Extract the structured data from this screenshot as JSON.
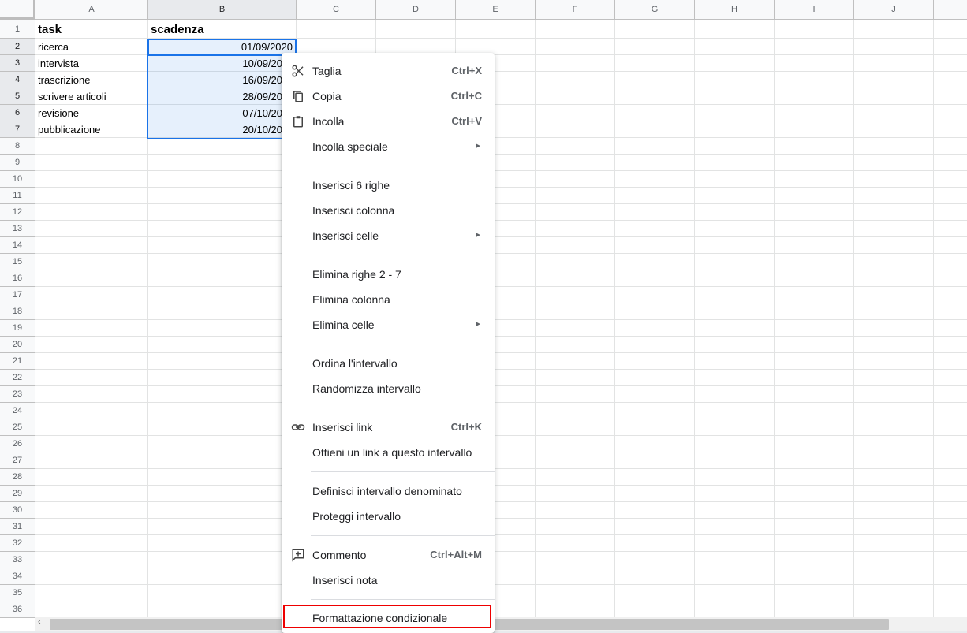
{
  "columns": [
    "A",
    "B",
    "C",
    "D",
    "E",
    "F",
    "G",
    "H",
    "I",
    "J"
  ],
  "rows": [
    "1",
    "2",
    "3",
    "4",
    "5",
    "6",
    "7",
    "8",
    "9",
    "10",
    "11",
    "12",
    "13",
    "14",
    "15",
    "16",
    "17",
    "18",
    "19",
    "20",
    "21",
    "22",
    "23",
    "24",
    "25",
    "26",
    "27",
    "28",
    "29",
    "30",
    "31",
    "32",
    "33",
    "34",
    "35",
    "36"
  ],
  "cells": {
    "A1": "task",
    "B1": "scadenza",
    "A2": "ricerca",
    "B2": "01/09/2020",
    "A3": "intervista",
    "B3": "10/09/20",
    "A4": "trascrizione",
    "B4": "16/09/20",
    "A5": "scrivere articoli",
    "B5": "28/09/20",
    "A6": "revisione",
    "B6": "07/10/20",
    "A7": "pubblicazione",
    "B7": "20/10/20"
  },
  "context_menu": {
    "cut": {
      "label": "Taglia",
      "shortcut": "Ctrl+X",
      "icon": "scissors-icon"
    },
    "copy": {
      "label": "Copia",
      "shortcut": "Ctrl+C",
      "icon": "copy-icon"
    },
    "paste": {
      "label": "Incolla",
      "shortcut": "Ctrl+V",
      "icon": "clipboard-icon"
    },
    "paste_special": {
      "label": "Incolla speciale",
      "arrow": "►"
    },
    "insert_rows": {
      "label": "Inserisci 6 righe"
    },
    "insert_column": {
      "label": "Inserisci colonna"
    },
    "insert_cells": {
      "label": "Inserisci celle",
      "arrow": "►"
    },
    "delete_rows": {
      "label": "Elimina righe 2 - 7"
    },
    "delete_column": {
      "label": "Elimina colonna"
    },
    "delete_cells": {
      "label": "Elimina celle",
      "arrow": "►"
    },
    "sort_range": {
      "label": "Ordina l'intervallo"
    },
    "randomize_range": {
      "label": "Randomizza intervallo"
    },
    "insert_link": {
      "label": "Inserisci link",
      "shortcut": "Ctrl+K",
      "icon": "link-icon"
    },
    "get_link": {
      "label": "Ottieni un link a questo intervallo"
    },
    "named_range": {
      "label": "Definisci intervallo denominato"
    },
    "protect_range": {
      "label": "Proteggi intervallo"
    },
    "comment": {
      "label": "Commento",
      "shortcut": "Ctrl+Alt+M",
      "icon": "add-comment-icon"
    },
    "insert_note": {
      "label": "Inserisci nota"
    },
    "conditional_formatting": {
      "label": "Formattazione condizionale",
      "highlight_color": "#e00000"
    }
  },
  "colors": {
    "selection_border": "#1a73e8",
    "selection_fill": "#e8f0fe",
    "highlight": "#e00000"
  }
}
